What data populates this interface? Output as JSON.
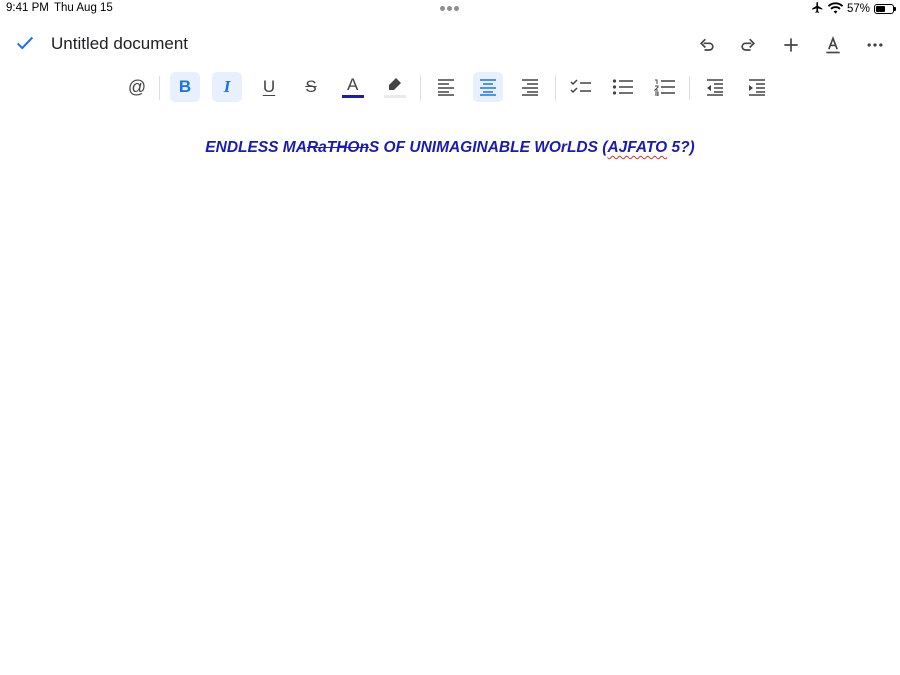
{
  "status": {
    "time": "9:41 PM",
    "date": "Thu Aug 15",
    "battery_pct": "57%",
    "battery_level": 0.57,
    "icons": [
      "airplane-icon",
      "wifi-icon",
      "battery-icon"
    ]
  },
  "document": {
    "title": "Untitled document",
    "text_segments": [
      {
        "text": "ENDLESS MA",
        "style": "plain"
      },
      {
        "text": "RaTHOn",
        "style": "strike"
      },
      {
        "text": "S OF UNIMAGINABLE WOrLDS (",
        "style": "plain"
      },
      {
        "text": "AJFATO",
        "style": "spell"
      },
      {
        "text": " 5?)",
        "style": "plain"
      }
    ]
  },
  "title_bar": {
    "actions": [
      "undo-icon",
      "redo-icon",
      "plus-icon",
      "text-format-icon",
      "more-icon"
    ]
  },
  "toolbar": {
    "bold_label": "B",
    "italic_label": "I",
    "underline_label": "U",
    "strike_label": "S",
    "text_color_label": "A",
    "mention_label": "@",
    "active": [
      "bold",
      "italic",
      "align-center"
    ]
  },
  "colors": {
    "accent": "#1a73e8",
    "active_bg": "#e8f0fe",
    "doc_text": "#1a1ab5",
    "text_color_bar": "#1a1ab5",
    "icon": "#5f6368"
  }
}
